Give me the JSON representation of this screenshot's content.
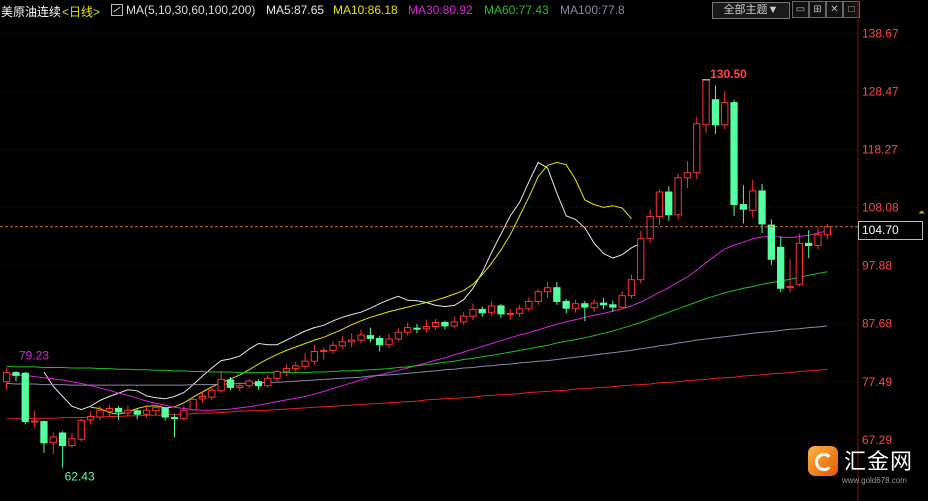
{
  "header": {
    "symbol": "美原油连续",
    "period": "<日线>",
    "ma_params": "MA(5,10,30,60,100,200)",
    "ma5": "MA5:87.65",
    "ma10": "MA10:86.18",
    "ma30": "MA30:80.92",
    "ma60": "MA60:77.43",
    "ma100": "MA100:77.8",
    "theme_button": "全部主题▼"
  },
  "price_box": "104.70",
  "logo": {
    "name": "汇金网",
    "url": "www.gold678.com"
  },
  "colors": {
    "background": "#000000",
    "up": "#ff3232",
    "down": "#54ff9f",
    "grid": "#7a1212",
    "ma5": "#e8e8e8",
    "ma10": "#e6e600",
    "ma30": "#e020e0",
    "ma60": "#20c020",
    "ma100": "#8a8aa8",
    "ma200": "#ee2020",
    "last_price_line": "#d46a3a",
    "axis_text": "#ff4646"
  },
  "chart_data": {
    "type": "candlestick",
    "y_axis_ticks": [
      "138.67",
      "128.47",
      "118.27",
      "108.08",
      "97.88",
      "87.68",
      "77.49",
      "67.29"
    ],
    "ylim": [
      62.0,
      141.0
    ],
    "last_price": 104.7,
    "annotations": {
      "high": "130.50",
      "low": "62.43",
      "prior_high": "79.23"
    },
    "candles": [
      [
        77.5,
        79.1,
        76.0,
        80.0
      ],
      [
        79.1,
        78.6,
        77.6,
        79.4
      ],
      [
        79.0,
        70.5,
        70.0,
        79.2
      ],
      [
        70.5,
        70.6,
        69.4,
        72.4
      ],
      [
        70.5,
        66.8,
        65.0,
        70.7
      ],
      [
        66.8,
        67.8,
        64.8,
        68.6
      ],
      [
        68.5,
        66.3,
        62.43,
        68.8
      ],
      [
        66.3,
        67.5,
        65.9,
        68.5
      ],
      [
        67.4,
        70.7,
        67.0,
        71.0
      ],
      [
        70.8,
        71.4,
        70.0,
        72.3
      ],
      [
        71.3,
        72.5,
        70.7,
        73.3
      ],
      [
        72.3,
        72.8,
        71.4,
        73.5
      ],
      [
        72.8,
        72.2,
        70.8,
        73.2
      ],
      [
        72.0,
        72.5,
        71.4,
        73.3
      ],
      [
        72.4,
        71.8,
        70.9,
        72.7
      ],
      [
        71.8,
        72.5,
        71.2,
        73.4
      ],
      [
        72.4,
        73.0,
        71.6,
        73.5
      ],
      [
        72.9,
        71.3,
        70.7,
        73.1
      ],
      [
        71.2,
        71.0,
        67.8,
        71.8
      ],
      [
        71.0,
        72.5,
        70.8,
        73.3
      ],
      [
        72.6,
        74.4,
        72.4,
        74.8
      ],
      [
        74.5,
        74.9,
        73.8,
        75.7
      ],
      [
        74.8,
        76.0,
        74.3,
        76.7
      ],
      [
        75.9,
        77.9,
        75.6,
        79.4
      ],
      [
        77.8,
        76.5,
        76.0,
        78.3
      ],
      [
        76.5,
        76.8,
        75.8,
        77.4
      ],
      [
        76.8,
        77.6,
        76.3,
        78.0
      ],
      [
        77.5,
        76.8,
        76.1,
        77.9
      ],
      [
        76.8,
        78.1,
        76.5,
        78.7
      ],
      [
        78.1,
        79.3,
        77.5,
        79.6
      ],
      [
        79.3,
        79.8,
        78.5,
        80.5
      ],
      [
        79.8,
        80.3,
        79.1,
        81.0
      ],
      [
        80.2,
        81.1,
        79.6,
        82.5
      ],
      [
        81.1,
        82.8,
        80.5,
        84.0
      ],
      [
        82.8,
        83.0,
        81.4,
        83.5
      ],
      [
        83.0,
        83.9,
        82.4,
        84.6
      ],
      [
        83.8,
        84.5,
        83.3,
        85.5
      ],
      [
        84.5,
        84.8,
        83.5,
        86.0
      ],
      [
        84.8,
        85.7,
        84.3,
        86.6
      ],
      [
        85.6,
        85.1,
        84.4,
        87.0
      ],
      [
        85.1,
        84.0,
        82.8,
        85.6
      ],
      [
        84.0,
        85.0,
        83.4,
        85.9
      ],
      [
        85.0,
        86.2,
        84.6,
        86.9
      ],
      [
        86.2,
        87.0,
        85.6,
        87.9
      ],
      [
        86.9,
        86.8,
        86.0,
        87.6
      ],
      [
        86.8,
        87.2,
        86.1,
        88.4
      ],
      [
        87.2,
        87.9,
        86.6,
        88.5
      ],
      [
        87.9,
        87.3,
        86.7,
        88.2
      ],
      [
        87.3,
        88.0,
        86.9,
        88.9
      ],
      [
        88.0,
        89.0,
        87.5,
        89.7
      ],
      [
        89.0,
        90.2,
        88.3,
        91.2
      ],
      [
        90.2,
        89.6,
        88.9,
        90.7
      ],
      [
        89.6,
        90.8,
        89.1,
        91.6
      ],
      [
        90.8,
        89.4,
        88.7,
        91.1
      ],
      [
        89.4,
        89.5,
        88.4,
        90.3
      ],
      [
        89.5,
        90.3,
        88.9,
        91.0
      ],
      [
        90.3,
        91.6,
        89.8,
        92.3
      ],
      [
        91.6,
        93.3,
        91.0,
        93.8
      ],
      [
        93.3,
        94.0,
        92.2,
        95.0
      ],
      [
        94.0,
        91.6,
        91.0,
        95.0
      ],
      [
        91.6,
        90.4,
        89.5,
        92.0
      ],
      [
        90.4,
        91.2,
        89.6,
        91.9
      ],
      [
        91.2,
        90.6,
        88.1,
        91.7
      ],
      [
        90.5,
        91.3,
        89.7,
        92.0
      ],
      [
        91.3,
        91.0,
        90.2,
        92.2
      ],
      [
        91.0,
        90.6,
        89.8,
        91.7
      ],
      [
        90.6,
        92.6,
        90.2,
        93.4
      ],
      [
        92.6,
        95.4,
        92.1,
        96.3
      ],
      [
        95.4,
        102.6,
        94.8,
        104.0
      ],
      [
        102.6,
        106.5,
        101.8,
        107.8
      ],
      [
        106.5,
        110.8,
        105.0,
        111.3
      ],
      [
        110.8,
        106.8,
        105.8,
        111.8
      ],
      [
        106.8,
        113.3,
        106.0,
        114.0
      ],
      [
        113.3,
        114.2,
        111.5,
        116.2
      ],
      [
        114.2,
        122.8,
        113.0,
        124.0
      ],
      [
        122.6,
        130.5,
        121.2,
        130.5
      ],
      [
        127.0,
        122.6,
        121.0,
        129.5
      ],
      [
        122.6,
        126.5,
        121.8,
        128.5
      ],
      [
        126.5,
        108.6,
        106.6,
        127.0
      ],
      [
        108.6,
        107.8,
        105.3,
        112.0
      ],
      [
        107.6,
        111.0,
        106.4,
        112.9
      ],
      [
        111.0,
        105.2,
        103.6,
        112.2
      ],
      [
        105.0,
        99.0,
        98.0,
        106.0
      ],
      [
        101.1,
        93.9,
        93.2,
        103.0
      ],
      [
        94.0,
        94.2,
        93.2,
        99.0
      ],
      [
        94.6,
        101.8,
        94.2,
        103.5
      ],
      [
        101.8,
        101.4,
        99.2,
        104.1
      ],
      [
        101.4,
        103.3,
        100.7,
        104.6
      ],
      [
        103.3,
        104.7,
        102.5,
        105.2
      ]
    ],
    "ma_series": [
      {
        "name": "MA5",
        "color": "#e8e8e8",
        "start": 4,
        "values": [
          79.2,
          76.7,
          74.9,
          73.2,
          72.6,
          73.2,
          74.2,
          74.9,
          75.5,
          76.1,
          75.9,
          75.0,
          74.7,
          74.5,
          74.9,
          75.6,
          77.0,
          78.5,
          79.9,
          81.2,
          81.5,
          82.0,
          83.2,
          84.2,
          84.0,
          84.0,
          84.8,
          85.6,
          86.4,
          87.0,
          87.4,
          88.2,
          88.8,
          89.3,
          89.7,
          90.4,
          91.2,
          91.9,
          92.5,
          91.8,
          91.7,
          91.4,
          90.9,
          90.7,
          90.9,
          91.9,
          93.9,
          96.7,
          100.2,
          103.4,
          106.6,
          109.0,
          112.6,
          116.0,
          115.0,
          110.6,
          106.6,
          106.0,
          104.5,
          101.8,
          100.0,
          99.2,
          99.8,
          101.0,
          101.8
        ]
      },
      {
        "name": "MA10",
        "color": "#e6e600",
        "start": 9,
        "values": [
          73.0,
          72.8,
          72.1,
          71.8,
          72.2,
          72.8,
          73.2,
          73.3,
          72.9,
          73.1,
          73.8,
          74.8,
          75.7,
          76.6,
          77.3,
          78.0,
          78.7,
          79.6,
          80.6,
          81.5,
          82.3,
          83.0,
          83.6,
          84.2,
          84.8,
          85.3,
          86.0,
          86.7,
          87.5,
          88.2,
          88.8,
          89.3,
          89.8,
          90.2,
          90.6,
          91.0,
          91.4,
          91.8,
          92.3,
          92.9,
          93.5,
          94.6,
          96.3,
          98.3,
          100.6,
          103.3,
          106.6,
          109.9,
          113.5,
          115.5,
          116.0,
          115.6,
          113.0,
          109.4,
          108.6,
          108.1,
          108.4,
          108.0,
          106.1
        ]
      },
      {
        "name": "MA30",
        "color": "#e020e0",
        "start": 0,
        "values": [
          78.8,
          78.7,
          78.6,
          78.4,
          78.2,
          78.0,
          77.8,
          77.5,
          77.2,
          76.8,
          76.4,
          76.0,
          75.5,
          75.1,
          74.6,
          74.1,
          73.7,
          73.4,
          73.0,
          72.8,
          72.6,
          72.5,
          72.5,
          72.6,
          72.7,
          72.9,
          73.1,
          73.4,
          73.7,
          74.0,
          74.3,
          74.6,
          74.9,
          75.3,
          75.8,
          76.3,
          76.8,
          77.3,
          77.8,
          78.3,
          78.7,
          79.1,
          79.5,
          79.9,
          80.4,
          80.8,
          81.3,
          81.7,
          82.2,
          82.7,
          83.2,
          83.7,
          84.2,
          84.7,
          85.2,
          85.7,
          86.1,
          86.6,
          87.1,
          87.6,
          88.0,
          88.4,
          88.8,
          89.2,
          89.5,
          89.9,
          90.3,
          90.8,
          91.5,
          92.3,
          93.2,
          94.0,
          95.0,
          95.9,
          97.1,
          98.4,
          99.6,
          100.8,
          101.5,
          102.0,
          102.6,
          102.9,
          103.0,
          102.9,
          102.8,
          103.0,
          103.2,
          103.6,
          104.0
        ]
      },
      {
        "name": "MA60",
        "color": "#20c020",
        "start": 0,
        "values": [
          80.2,
          80.1,
          80.1,
          80.1,
          80.0,
          80.0,
          80.0,
          79.9,
          79.9,
          79.9,
          79.8,
          79.8,
          79.7,
          79.7,
          79.6,
          79.6,
          79.5,
          79.5,
          79.4,
          79.4,
          79.3,
          79.3,
          79.2,
          79.2,
          79.2,
          79.1,
          79.1,
          79.1,
          79.1,
          79.1,
          79.1,
          79.1,
          79.1,
          79.2,
          79.2,
          79.3,
          79.4,
          79.4,
          79.5,
          79.6,
          79.7,
          79.8,
          80.0,
          80.1,
          80.3,
          80.5,
          80.7,
          80.9,
          81.1,
          81.4,
          81.6,
          81.9,
          82.1,
          82.4,
          82.7,
          83.0,
          83.3,
          83.6,
          83.9,
          84.3,
          84.6,
          84.9,
          85.2,
          85.6,
          86.0,
          86.4,
          86.9,
          87.4,
          87.9,
          88.5,
          89.1,
          89.7,
          90.3,
          90.9,
          91.5,
          92.1,
          92.6,
          93.1,
          93.5,
          93.9,
          94.2,
          94.6,
          94.9,
          95.2,
          95.5,
          95.8,
          96.2,
          96.5,
          96.8
        ]
      },
      {
        "name": "MA100",
        "color": "#8a8aa8",
        "start": 0,
        "values": [
          77.2,
          77.1,
          77.1,
          77.1,
          77.0,
          77.0,
          77.0,
          76.9,
          76.9,
          76.9,
          76.9,
          76.9,
          76.9,
          76.9,
          76.9,
          76.9,
          76.9,
          76.9,
          76.9,
          76.9,
          77.0,
          77.0,
          77.0,
          77.1,
          77.1,
          77.2,
          77.2,
          77.3,
          77.4,
          77.4,
          77.5,
          77.6,
          77.7,
          77.8,
          77.9,
          78.0,
          78.1,
          78.2,
          78.3,
          78.5,
          78.6,
          78.7,
          78.8,
          79.0,
          79.1,
          79.3,
          79.4,
          79.6,
          79.7,
          79.9,
          80.0,
          80.2,
          80.3,
          80.5,
          80.6,
          80.8,
          80.9,
          81.1,
          81.2,
          81.4,
          81.6,
          81.8,
          82.0,
          82.2,
          82.4,
          82.6,
          82.8,
          83.0,
          83.3,
          83.5,
          83.8,
          84.0,
          84.3,
          84.5,
          84.8,
          85.0,
          85.2,
          85.4,
          85.6,
          85.8,
          86.0,
          86.2,
          86.3,
          86.5,
          86.7,
          86.8,
          87.0,
          87.1,
          87.3
        ]
      },
      {
        "name": "MA200",
        "color": "#ee2020",
        "start": 0,
        "values": [
          71.0,
          71.0,
          71.0,
          71.1,
          71.1,
          71.1,
          71.2,
          71.2,
          71.2,
          71.3,
          71.3,
          71.4,
          71.4,
          71.5,
          71.5,
          71.6,
          71.6,
          71.7,
          71.8,
          71.8,
          71.9,
          72.0,
          72.0,
          72.1,
          72.2,
          72.3,
          72.4,
          72.4,
          72.5,
          72.6,
          72.7,
          72.8,
          72.9,
          73.0,
          73.1,
          73.2,
          73.3,
          73.4,
          73.5,
          73.6,
          73.7,
          73.8,
          73.9,
          74.0,
          74.1,
          74.3,
          74.4,
          74.5,
          74.6,
          74.7,
          74.8,
          75.0,
          75.1,
          75.2,
          75.3,
          75.4,
          75.6,
          75.7,
          75.8,
          75.9,
          76.0,
          76.2,
          76.3,
          76.4,
          76.5,
          76.6,
          76.8,
          76.9,
          77.0,
          77.1,
          77.3,
          77.4,
          77.5,
          77.7,
          77.8,
          77.9,
          78.1,
          78.2,
          78.3,
          78.5,
          78.6,
          78.7,
          78.9,
          79.0,
          79.1,
          79.3,
          79.4,
          79.5,
          79.7
        ]
      }
    ]
  }
}
